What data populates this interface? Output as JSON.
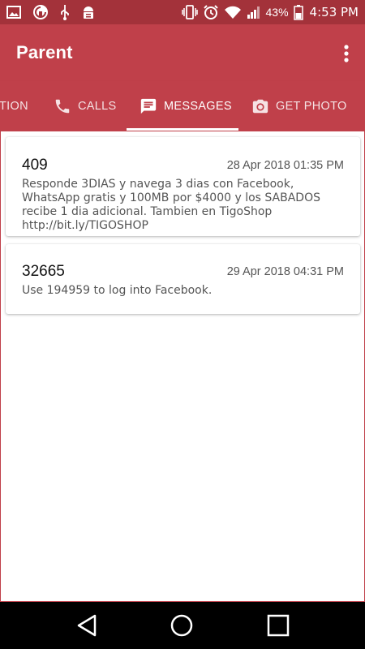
{
  "status_bar": {
    "time": "4:53 PM",
    "battery_percent": "43%",
    "icons": [
      "image-icon",
      "sync-icon",
      "usb-icon",
      "android-debug-icon",
      "vibrate-icon",
      "alarm-icon",
      "wifi-icon",
      "signal-icon",
      "battery-icon"
    ]
  },
  "app_bar": {
    "title": "Parent",
    "overflow_icon": "more-vert-icon"
  },
  "tabs": [
    {
      "label": "TION",
      "icon": ""
    },
    {
      "label": "CALLS",
      "icon": "phone-icon"
    },
    {
      "label": "MESSAGES",
      "icon": "message-icon",
      "active": true
    },
    {
      "label": "GET PHOTO",
      "icon": "camera-icon"
    }
  ],
  "messages": [
    {
      "sender": "409",
      "date": "28 Apr 2018 01:35 PM",
      "body": "Responde 3DIAS y navega 3 dias con Facebook, WhatsApp gratis y 100MB por $4000 y los SABADOS recibe 1 dia adicional. Tambien en TigoShop http://bit.ly/TIGOSHOP"
    },
    {
      "sender": "32665",
      "date": "29 Apr 2018 04:31 PM",
      "body": "Use 194959 to log into Facebook."
    }
  ],
  "nav_bar": {
    "icons": [
      "back-icon",
      "home-icon",
      "recents-icon"
    ]
  },
  "colors": {
    "status_bar": "#a3323a",
    "app_bar": "#c0404a",
    "text_primary": "#111111",
    "text_secondary": "#555555"
  }
}
